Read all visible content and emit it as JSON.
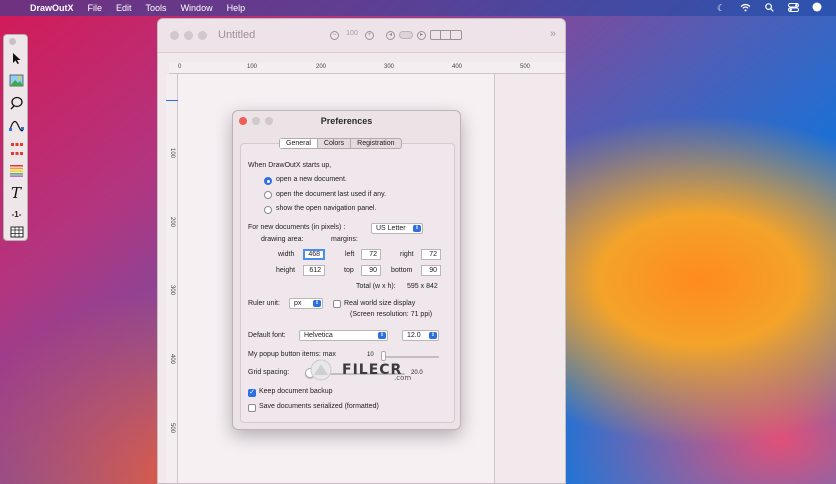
{
  "menubar": {
    "app": "DrawOutX",
    "items": [
      "File",
      "Edit",
      "Tools",
      "Window",
      "Help"
    ]
  },
  "document": {
    "title": "Untitled",
    "zoom": "100",
    "ruler_top": [
      "0",
      "100",
      "200",
      "300",
      "400",
      "500"
    ],
    "ruler_left": [
      "100",
      "200",
      "300",
      "400",
      "500"
    ]
  },
  "toolbox": {
    "tools": [
      "arrow-tool-icon",
      "image-tool-icon",
      "lasso-tool-icon",
      "bezier-tool-icon",
      "selection-handles-icon",
      "color-lines-icon",
      "text-tool-icon",
      "ruler-tool-icon",
      "table-tool-icon"
    ],
    "ruler_label": "-1-"
  },
  "prefs": {
    "title": "Preferences",
    "tabs": [
      "General",
      "Colors",
      "Registration"
    ],
    "selected_tab": "General",
    "startup_label": "When DrawOutX starts up,",
    "startup_options": [
      "open a new document.",
      "open the document last used if any.",
      "show the open navigation panel."
    ],
    "startup_selected": 0,
    "new_docs_label": "For new documents (in pixels) :",
    "paper_size": "US Letter",
    "drawing_area_label": "drawing area:",
    "margins_label": "margins:",
    "width_label": "width",
    "width": "468",
    "height_label": "height",
    "height": "612",
    "left_label": "left",
    "left": "72",
    "right_label": "right",
    "right": "72",
    "top_label": "top",
    "top": "90",
    "bottom_label": "bottom",
    "bottom": "90",
    "total_label": "Total (w x h):",
    "total": "595 x 842",
    "ruler_unit_label": "Ruler unit:",
    "ruler_unit": "px",
    "real_world_label": "Real world size display",
    "real_world_checked": false,
    "screen_res": "(Screen resolution: 71 ppi)",
    "default_font_label": "Default font:",
    "font": "Helvetica",
    "font_size": "12.0",
    "popup_items_label": "My popup button items: max",
    "popup_items_value": "10",
    "grid_label": "Grid spacing:",
    "grid_value": "20.0",
    "keep_backup_label": "Keep document backup",
    "keep_backup_checked": true,
    "serialized_label": "Save documents serialized (formatted)",
    "serialized_checked": false
  },
  "watermark": {
    "text": "FILECR",
    "sub": ".com"
  },
  "colors": {
    "accent": "#2d6fe3",
    "close": "#ee5e56"
  }
}
